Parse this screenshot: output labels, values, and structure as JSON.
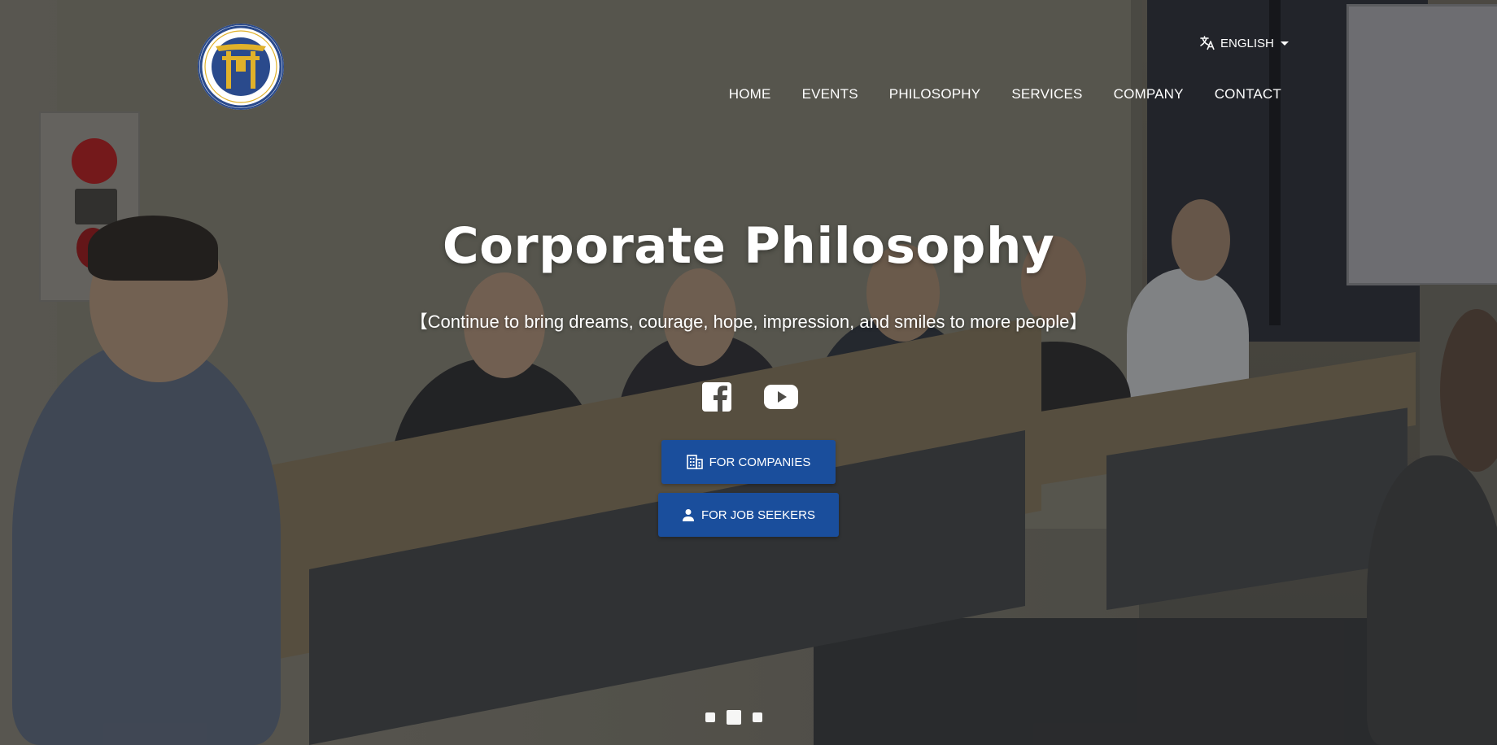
{
  "header": {
    "logo_name": "manabiya-logo",
    "language": {
      "label": "ENGLISH",
      "icon": "translate-icon"
    },
    "nav": [
      {
        "label": "HOME"
      },
      {
        "label": "EVENTS"
      },
      {
        "label": "PHILOSOPHY"
      },
      {
        "label": "SERVICES"
      },
      {
        "label": "COMPANY"
      },
      {
        "label": "CONTACT"
      }
    ]
  },
  "hero": {
    "title": "Corporate Philosophy",
    "subtitle": "【Continue to bring dreams, courage, hope, impression, and smiles to more people】",
    "social": [
      {
        "icon": "facebook-icon"
      },
      {
        "icon": "youtube-icon"
      }
    ],
    "buttons": {
      "companies": {
        "label": "FOR COMPANIES",
        "icon": "building-icon"
      },
      "job_seekers": {
        "label": "FOR JOB SEEKERS",
        "icon": "person-icon"
      }
    },
    "carousel": {
      "slide_count": 3,
      "active_index": 1
    }
  },
  "colors": {
    "button_bg": "#1a4e9c",
    "text": "#ffffff",
    "logo_blue": "#2a4a8c",
    "logo_gold": "#e0b12a"
  }
}
